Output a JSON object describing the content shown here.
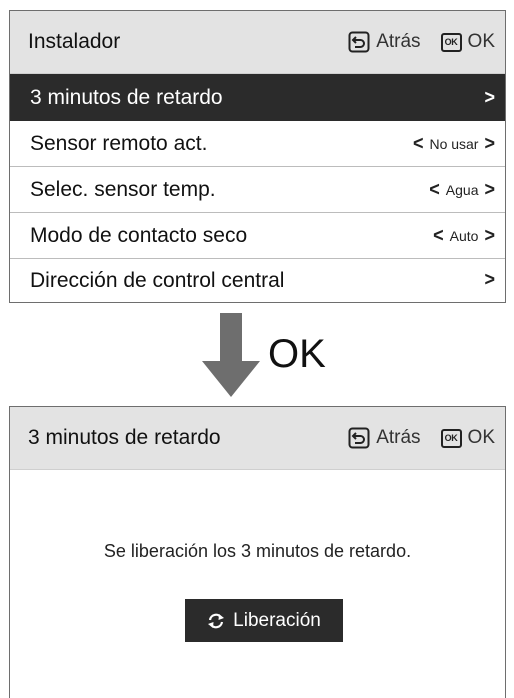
{
  "screen1": {
    "header": {
      "title": "Instalador",
      "back_label": "Atrás",
      "ok_badge": "OK",
      "ok_label": "OK"
    },
    "menu": [
      {
        "label": "3 minutos de retardo",
        "value": "",
        "selected": true
      },
      {
        "label": "Sensor remoto act.",
        "value": "No usar"
      },
      {
        "label": "Selec. sensor temp.",
        "value": "Agua"
      },
      {
        "label": "Modo de contacto seco",
        "value": "Auto"
      },
      {
        "label": "Dirección de control central",
        "value": ""
      }
    ]
  },
  "transition": {
    "label": "OK"
  },
  "screen2": {
    "header": {
      "title": "3 minutos de retardo",
      "back_label": "Atrás",
      "ok_badge": "OK",
      "ok_label": "OK"
    },
    "message": "Se liberación los 3 minutos de retardo.",
    "release_button": {
      "label": "Liberación",
      "icon": "refresh-icon"
    }
  },
  "colors": {
    "header_bg": "#e3e3e3",
    "selected_bg": "#2b2b2b",
    "arrow": "#6e6e6e"
  }
}
